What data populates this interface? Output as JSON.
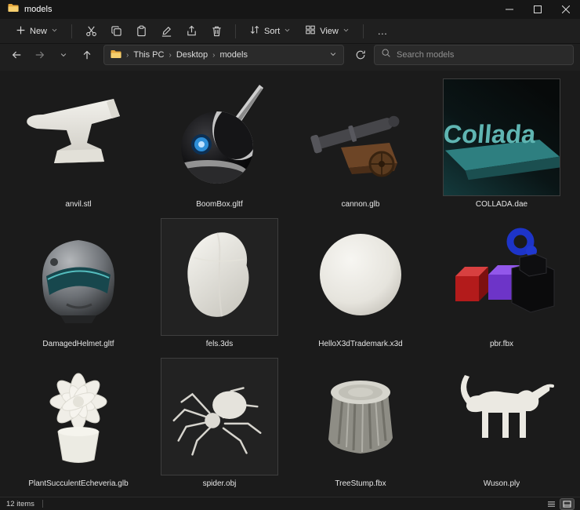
{
  "window": {
    "title": "models"
  },
  "toolbar": {
    "new_label": "New",
    "sort_label": "Sort",
    "view_label": "View",
    "more_label": "…"
  },
  "address_bar": {
    "breadcrumb": {
      "root": "This PC",
      "parent": "Desktop",
      "current": "models",
      "separator": "›"
    },
    "search_placeholder": "Search models"
  },
  "files": [
    {
      "name": "anvil.stl"
    },
    {
      "name": "BoomBox.gltf"
    },
    {
      "name": "cannon.glb"
    },
    {
      "name": "COLLADA.dae"
    },
    {
      "name": "DamagedHelmet.gltf"
    },
    {
      "name": "fels.3ds"
    },
    {
      "name": "HelloX3dTrademark.x3d"
    },
    {
      "name": "pbr.fbx"
    },
    {
      "name": "PlantSucculentEcheveria.glb"
    },
    {
      "name": "spider.obj"
    },
    {
      "name": "TreeStump.fbx"
    },
    {
      "name": "Wuson.ply"
    }
  ],
  "status_bar": {
    "items_count": "12 items"
  },
  "colors": {
    "folder_yellow": "#f0c05a",
    "collada_teal": "#57b3b0",
    "boombox_blue": "#2e8fd8"
  }
}
